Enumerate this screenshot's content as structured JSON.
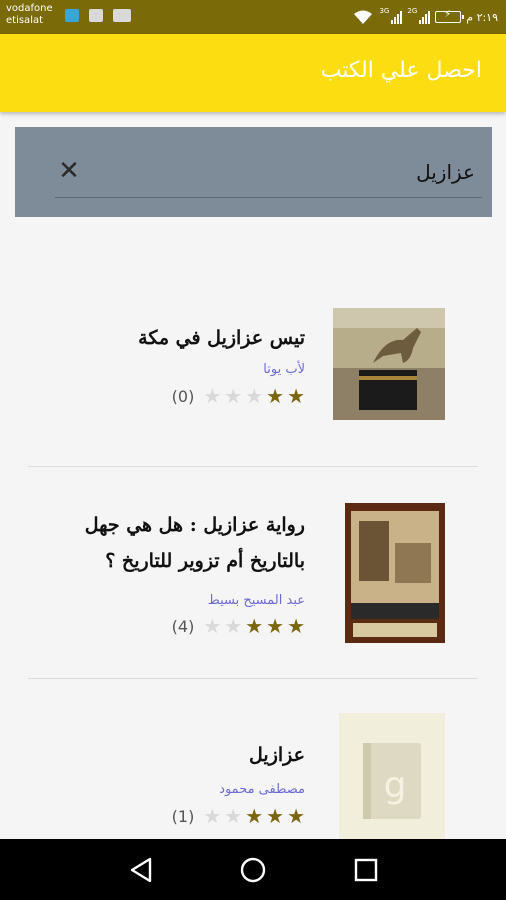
{
  "status_bar": {
    "carrier_line1": "vodafone",
    "carrier_line2": "etisalat",
    "net_label_1": "3G",
    "net_label_2": "2G",
    "time": "٢:١٩ م"
  },
  "app_bar": {
    "title": "احصل علي الكتب"
  },
  "search": {
    "value": "عزازيل",
    "placeholder": ""
  },
  "results": [
    {
      "title_lines": [
        "تيس عزازيل في مكة"
      ],
      "author": "لأب يوتا",
      "stars_filled": 2,
      "stars_total": 5,
      "count": "(0)",
      "cover": "goat-kaaba"
    },
    {
      "title_lines": [
        "رواية عزازيل : هل هي جهل",
        "بالتاريخ أم تزوير للتاريخ ؟"
      ],
      "author": "عبد المسيح بسيط",
      "stars_filled": 3,
      "stars_total": 5,
      "count": "(4)",
      "cover": "book-painting"
    },
    {
      "title_lines": [
        "عزازيل"
      ],
      "author": "مصطفى محمود",
      "stars_filled": 3,
      "stars_total": 5,
      "count": "(1)",
      "cover": "placeholder-g"
    }
  ],
  "colors": {
    "status_bar": "#7a6a08",
    "app_bar": "#fcdd12",
    "search_bg": "#7e8b99",
    "author": "#6b6bd6",
    "star_on": "#7b6610"
  }
}
